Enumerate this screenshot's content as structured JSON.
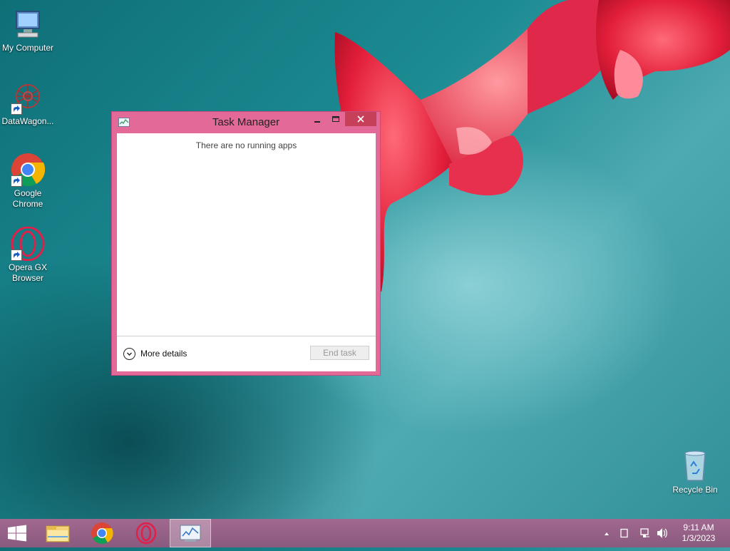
{
  "desktop": {
    "icons": [
      {
        "label": "My Computer",
        "icon": "my-computer-icon"
      },
      {
        "label": "DataWagon...",
        "icon": "datawagon-icon"
      },
      {
        "label": "Google Chrome",
        "icon": "chrome-icon"
      },
      {
        "label": "Opera GX Browser",
        "icon": "opera-gx-icon"
      },
      {
        "label": "Recycle Bin",
        "icon": "recycle-bin-icon"
      }
    ]
  },
  "task_manager": {
    "title": "Task Manager",
    "empty_message": "There are no running apps",
    "more_details_label": "More details",
    "end_task_label": "End task",
    "accent_color": "#e36a98",
    "close_color": "#c7405a"
  },
  "taskbar": {
    "items": [
      "start-icon",
      "file-explorer-icon",
      "chrome-icon",
      "opera-gx-icon",
      "task-manager-icon"
    ],
    "tray_icons": [
      "show-hidden-icons",
      "action-center-icon",
      "network-icon",
      "volume-icon"
    ],
    "time": "9:11 AM",
    "date": "1/3/2023",
    "color": "#8a5a7f"
  }
}
